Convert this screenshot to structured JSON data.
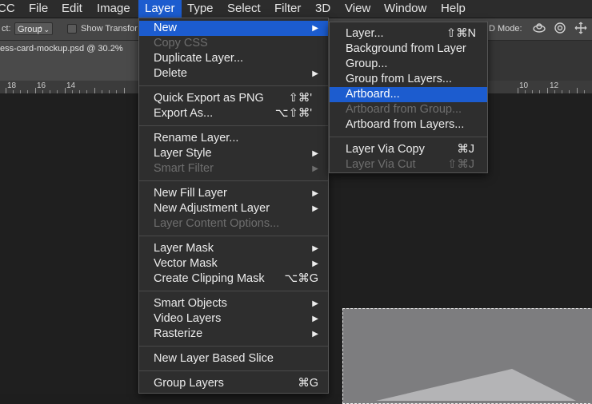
{
  "menubar": {
    "items": [
      "CC",
      "File",
      "Edit",
      "Image",
      "Layer",
      "Type",
      "Select",
      "Filter",
      "3D",
      "View",
      "Window",
      "Help"
    ]
  },
  "options_bar": {
    "auto_select_label": "ct:",
    "auto_select_value": "Group",
    "show_transform_label": "Show Transfor",
    "mode_label": "D Mode:"
  },
  "document": {
    "tab_title": "ess-card-mockup.psd @ 30.2%",
    "ruler_labels": [
      "18",
      "16",
      "14",
      "10",
      "12"
    ]
  },
  "layer_menu": {
    "items": [
      {
        "label": "New",
        "submenu": true,
        "highlight": true
      },
      {
        "label": "Copy CSS",
        "disabled": true
      },
      {
        "label": "Duplicate Layer..."
      },
      {
        "label": "Delete",
        "submenu": true
      },
      {
        "label": "Quick Export as PNG",
        "shortcut": "⇧⌘'"
      },
      {
        "label": "Export As...",
        "shortcut": "⌥⇧⌘'"
      },
      {
        "label": "Rename Layer..."
      },
      {
        "label": "Layer Style",
        "submenu": true
      },
      {
        "label": "Smart Filter",
        "submenu": true,
        "disabled": true
      },
      {
        "label": "New Fill Layer",
        "submenu": true
      },
      {
        "label": "New Adjustment Layer",
        "submenu": true
      },
      {
        "label": "Layer Content Options...",
        "disabled": true
      },
      {
        "label": "Layer Mask",
        "submenu": true
      },
      {
        "label": "Vector Mask",
        "submenu": true
      },
      {
        "label": "Create Clipping Mask",
        "shortcut": "⌥⌘G"
      },
      {
        "label": "Smart Objects",
        "submenu": true
      },
      {
        "label": "Video Layers",
        "submenu": true
      },
      {
        "label": "Rasterize",
        "submenu": true
      },
      {
        "label": "New Layer Based Slice"
      },
      {
        "label": "Group Layers",
        "shortcut": "⌘G"
      }
    ]
  },
  "new_submenu": {
    "items": [
      {
        "label": "Layer...",
        "shortcut": "⇧⌘N"
      },
      {
        "label": "Background from Layer"
      },
      {
        "label": "Group..."
      },
      {
        "label": "Group from Layers..."
      },
      {
        "label": "Artboard...",
        "highlight": true
      },
      {
        "label": "Artboard from Group...",
        "disabled": true
      },
      {
        "label": "Artboard from Layers..."
      },
      {
        "label": "Layer Via Copy",
        "shortcut": "⌘J"
      },
      {
        "label": "Layer Via Cut",
        "shortcut": "⇧⌘J",
        "disabled": true
      }
    ]
  },
  "icons": {
    "submenu_arrow": "▶",
    "select_arrows": "⌃⌄"
  },
  "colors": {
    "highlight": "#1c5ccf",
    "menu_bg": "#2e2e2e",
    "disabled_text": "#6e6e6e"
  }
}
